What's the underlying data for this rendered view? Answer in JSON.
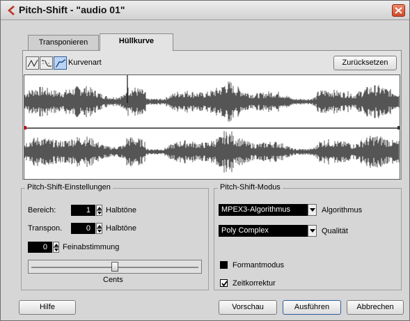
{
  "window": {
    "title": "Pitch-Shift - \"audio 01\""
  },
  "tabs": [
    {
      "label": "Transponieren",
      "active": false
    },
    {
      "label": "Hüllkurve",
      "active": true
    }
  ],
  "curve": {
    "type_label": "Kurvenart",
    "reset_label": "Zurücksetzen",
    "buttons": [
      "linear-curve-icon",
      "spline-curve-icon",
      "smooth-curve-icon"
    ],
    "selected_button": 2
  },
  "settings": {
    "title": "Pitch-Shift-Einstellungen",
    "range_label": "Bereich:",
    "range_value": "1",
    "range_unit": "Halbtöne",
    "transpose_label": "Transpon.",
    "transpose_value": "0",
    "transpose_unit": "Halbtöne",
    "fine_value": "0",
    "fine_label": "Feinabstimmung",
    "slider_label": "Cents",
    "slider_fraction": 0.5
  },
  "mode": {
    "title": "Pitch-Shift-Modus",
    "algorithm_value": "MPEX3-Algorithmus",
    "algorithm_label": "Algorithmus",
    "quality_value": "Poly Complex",
    "quality_label": "Qualität",
    "formant_label": "Formantmodus",
    "formant_checked": false,
    "timecorr_label": "Zeitkorrektur",
    "timecorr_checked": true
  },
  "footer": {
    "help_label": "Hilfe",
    "preview_label": "Vorschau",
    "execute_label": "Ausführen",
    "cancel_label": "Abbrechen"
  },
  "colors": {
    "window_bg": "#d6d6d6",
    "panel_bg": "#e3e3e3",
    "waveform": "#555555",
    "selected_button": "#bcd4f4",
    "envelope_marker": "#cc0000"
  }
}
